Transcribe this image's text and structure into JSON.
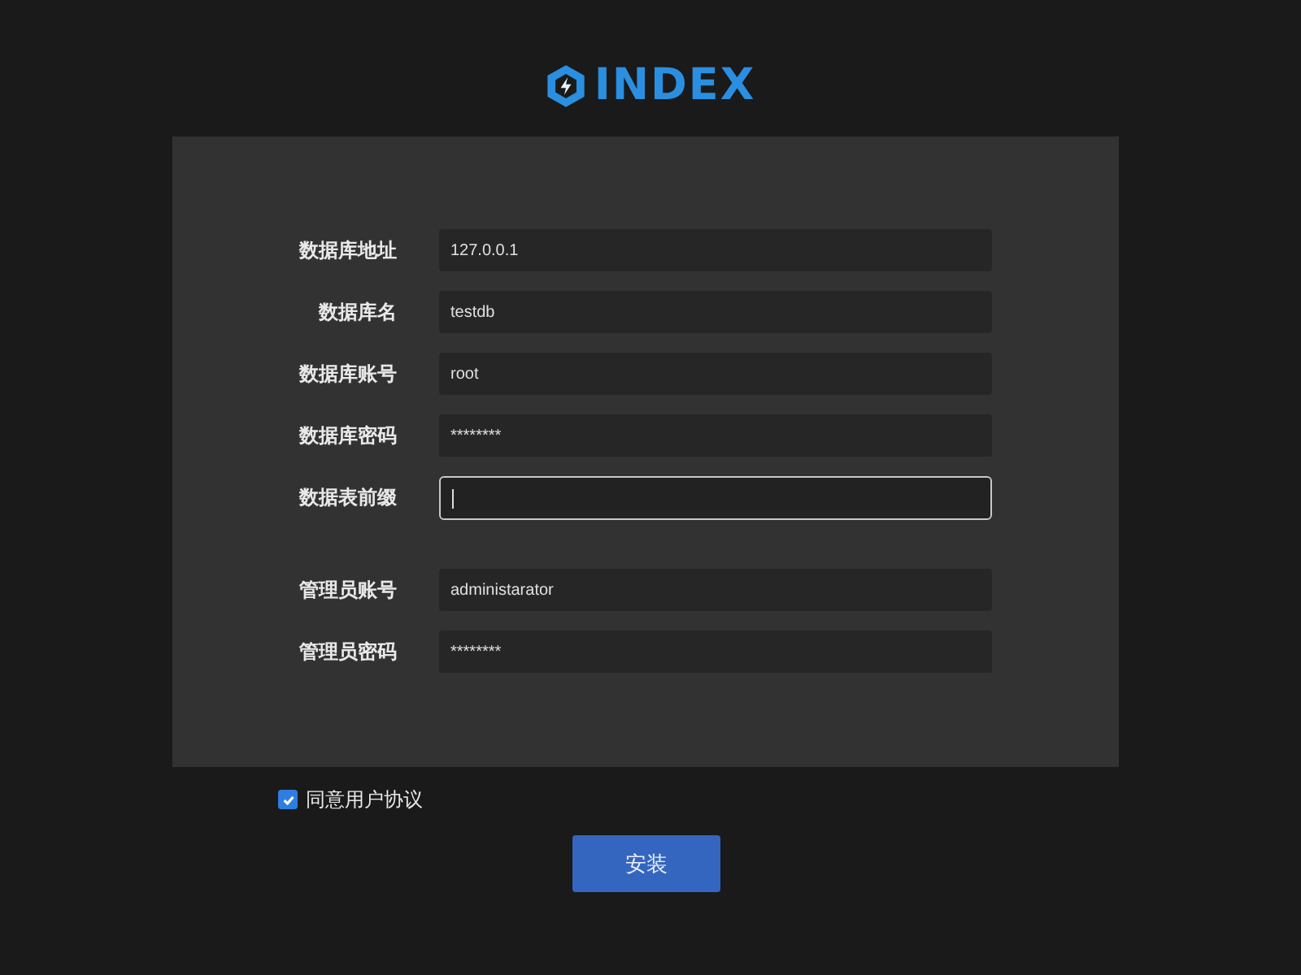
{
  "logo": {
    "text": "INDEX"
  },
  "groups": [
    {
      "fields": [
        {
          "label": "数据库地址",
          "value": "127.0.0.1",
          "focused": false
        },
        {
          "label": "数据库名",
          "value": "testdb",
          "focused": false
        },
        {
          "label": "数据库账号",
          "value": "root",
          "focused": false
        },
        {
          "label": "数据库密码",
          "value": "********",
          "focused": false
        },
        {
          "label": "数据表前缀",
          "focused": true
        }
      ]
    },
    {
      "fields": [
        {
          "label": "管理员账号",
          "value": "administarator",
          "focused": false
        },
        {
          "label": "管理员密码",
          "value": "********",
          "focused": false
        }
      ]
    }
  ],
  "agreement": {
    "label": "同意用户协议",
    "checked": true
  },
  "submit": {
    "label": "安装"
  }
}
